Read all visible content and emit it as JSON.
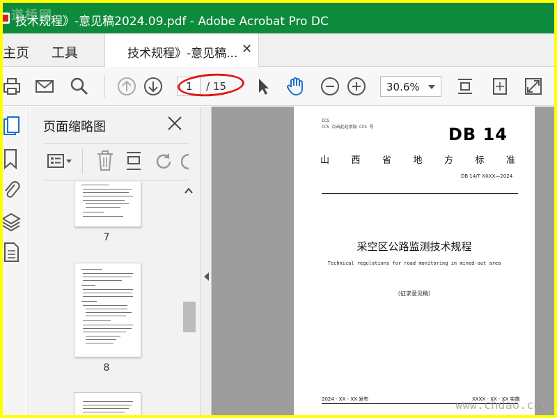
{
  "window": {
    "title": "技术规程》-意见稿2024.09.pdf - Adobe Acrobat Pro DC",
    "watermark_top": "道桥网",
    "watermark_bottom": "www.chdao.co",
    "accent": "#0e8a3c"
  },
  "tabs": {
    "home": "主页",
    "tools": "工具",
    "document": "技术规程》-意见稿..."
  },
  "toolbar": {
    "current_page": "1",
    "page_total": "/ 15",
    "zoom": "30.6%",
    "annotation_color": "#e01616"
  },
  "panel": {
    "title": "页面缩略图",
    "thumbnails": [
      {
        "label": "7"
      },
      {
        "label": "8"
      },
      {
        "label": ""
      }
    ]
  },
  "document": {
    "ics_line1": "ICS",
    "ics_line2": "CCS  点击此处添加 CCS 号",
    "standard_mark": "DB 14",
    "province_chars": [
      "山",
      "西",
      "省",
      "地",
      "方",
      "标",
      "准"
    ],
    "standard_code": "DB 14/T XXXX—2024",
    "title_cn": "采空区公路监测技术规程",
    "title_en": "Technical regulations for road monitoring in mined-out area",
    "draft_label": "（征求意见稿）",
    "publish_date": "2024 - XX - XX 发布",
    "implement_date": "XXXX - XX - XX 实施"
  }
}
